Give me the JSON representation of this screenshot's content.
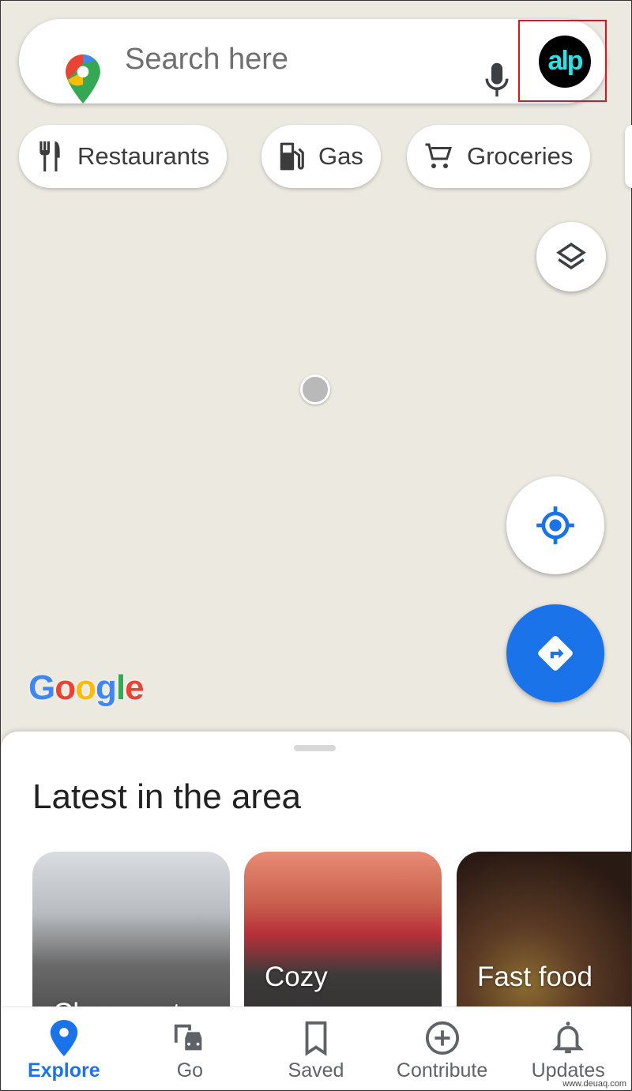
{
  "search": {
    "placeholder": "Search here",
    "avatar_text": "alp"
  },
  "chips": [
    {
      "label": "Restaurants",
      "icon": "fork-knife-icon"
    },
    {
      "label": "Gas",
      "icon": "gas-pump-icon"
    },
    {
      "label": "Groceries",
      "icon": "cart-icon"
    }
  ],
  "map": {
    "logo": "Google",
    "accent": "#1a73e8"
  },
  "sheet": {
    "title": "Latest in the area",
    "cards": [
      {
        "label": "Cheap eats"
      },
      {
        "label": "Cozy restaurants"
      },
      {
        "label": "Fast food restaurants"
      }
    ]
  },
  "nav": [
    {
      "label": "Explore",
      "icon": "pin-icon",
      "active": true
    },
    {
      "label": "Go",
      "icon": "commute-icon"
    },
    {
      "label": "Saved",
      "icon": "bookmark-icon"
    },
    {
      "label": "Contribute",
      "icon": "add-circle-icon"
    },
    {
      "label": "Updates",
      "icon": "bell-icon"
    }
  ],
  "watermark": "www.deuaq.com"
}
